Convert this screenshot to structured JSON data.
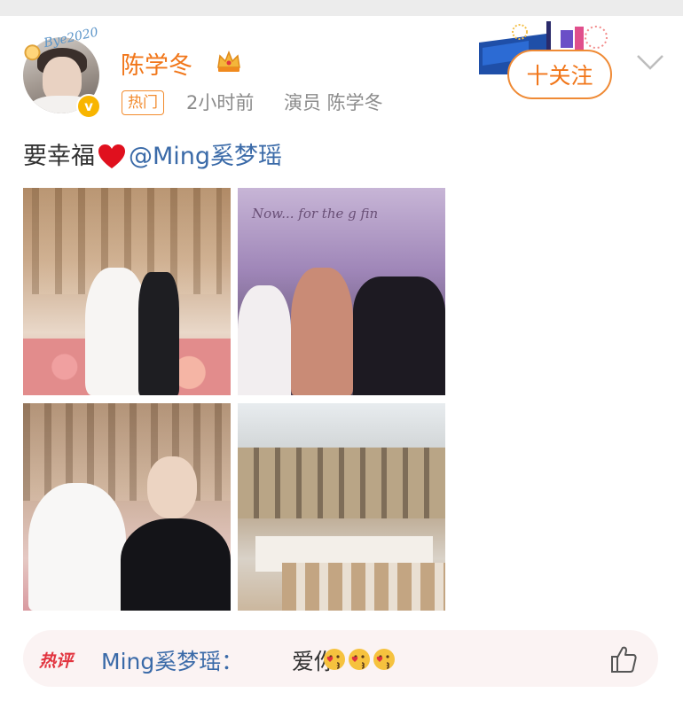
{
  "post": {
    "author": {
      "name": "陈学冬",
      "avatar_decoration_text": "Bye2020",
      "verified_icon": "verified-badge-icon",
      "crown_icon": "crown-icon"
    },
    "hot_badge": "热门",
    "time": "2小时前",
    "source": "演员 陈学冬",
    "follow_label": "十关注",
    "text": "要幸福",
    "heart_icon": "red-heart",
    "mention": "@Ming奚梦瑶",
    "photo_caption": "Now... for the g    fin",
    "images": [
      {
        "name": "wedding-kiss-photo"
      },
      {
        "name": "party-crowd-photo"
      },
      {
        "name": "bride-selfie-photo"
      },
      {
        "name": "courtyard-banquet-photo"
      }
    ]
  },
  "hot_comment": {
    "tag": "热评",
    "user": "Ming奚梦瑶",
    "separator": "：",
    "text": "爱你",
    "emoji": [
      "kiss-face-emoji",
      "kiss-face-emoji",
      "kiss-face-emoji"
    ]
  },
  "colors": {
    "username": "#f17619",
    "link": "#3a6aa8",
    "hot_tag": "#e2343f",
    "follow_border": "#ef8a35"
  }
}
